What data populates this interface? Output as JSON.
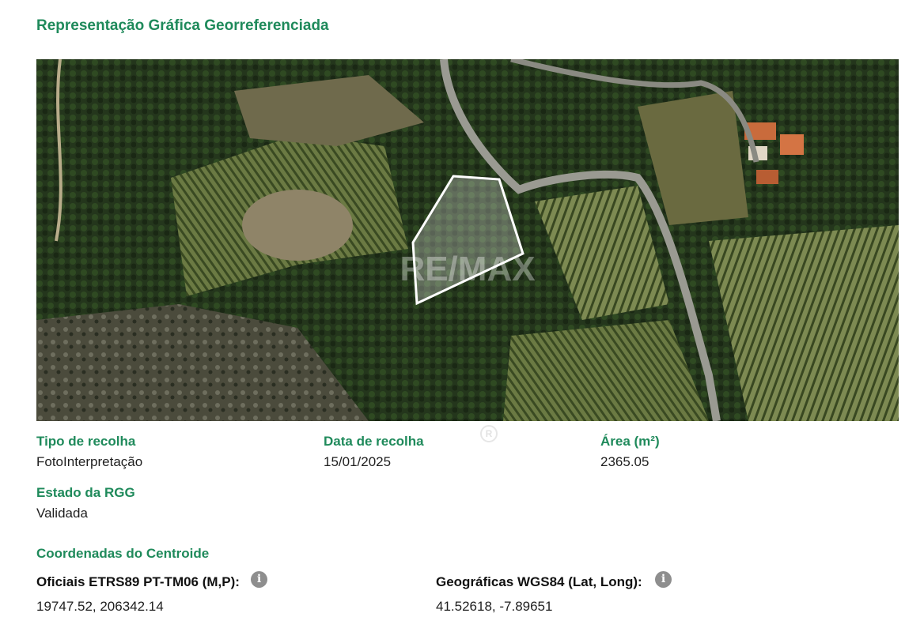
{
  "section": {
    "title": "Representação Gráfica Georreferenciada"
  },
  "map": {
    "image": "satellite-aerial-map",
    "parcel_outline_color": "#ffffff",
    "watermark": "RE/MAX"
  },
  "details": {
    "tipo_label": "Tipo de recolha",
    "tipo_value": "FotoInterpretação",
    "data_label": "Data de recolha",
    "data_value": "15/01/2025",
    "area_label": "Área (m²)",
    "area_value": "2365.05",
    "estado_label": "Estado da RGG",
    "estado_value": "Validada"
  },
  "coordinates": {
    "heading": "Coordenadas do Centroide",
    "oficiais_label": "Oficiais ETRS89 PT-TM06 (M,P):",
    "oficiais_value": "19747.52, 206342.14",
    "geograficas_label": "Geográficas WGS84 (Lat, Long):",
    "geograficas_value": "41.52618, -7.89651",
    "info_icon": "info-icon"
  },
  "colors": {
    "accent": "#1f8a5b",
    "text": "#1f1f1f",
    "info_icon": "#8e8e8e"
  }
}
